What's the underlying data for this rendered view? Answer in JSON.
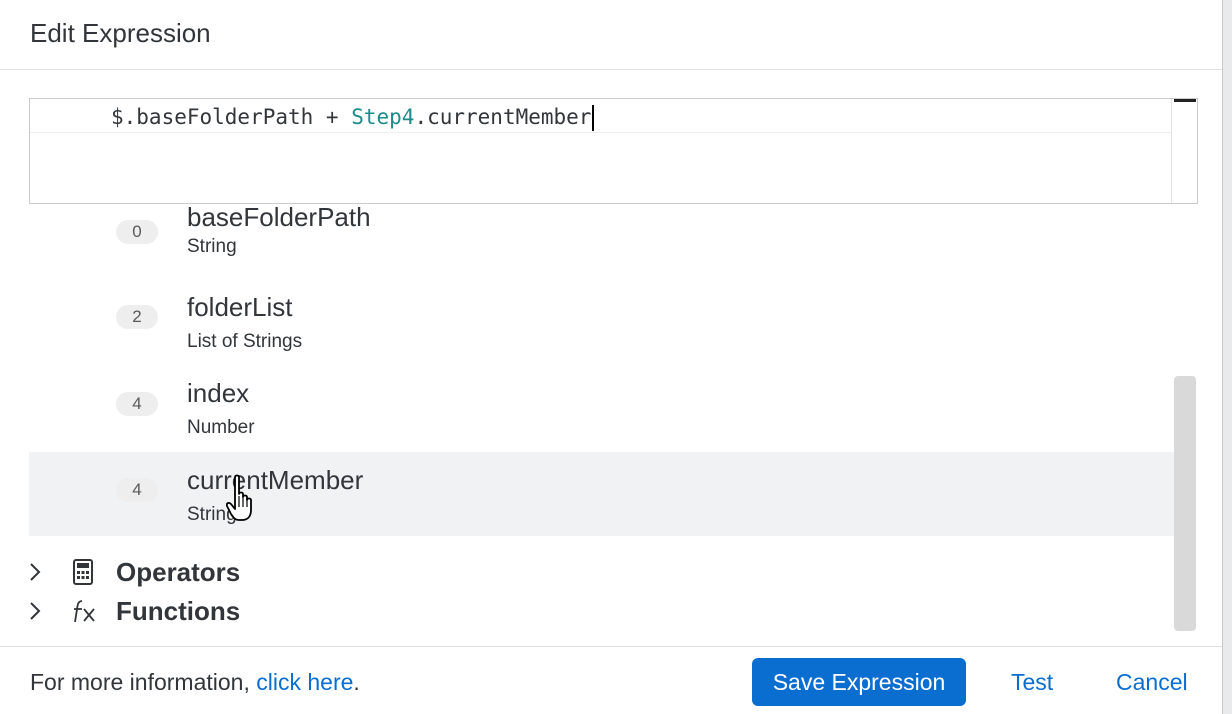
{
  "dialog": {
    "title": "Edit Expression"
  },
  "editor": {
    "code_prefix": "$.baseFolderPath + ",
    "code_step": "Step4",
    "code_suffix": ".currentMember"
  },
  "variables": [
    {
      "badge": "0",
      "name": "baseFolderPath",
      "type": "String"
    },
    {
      "badge": "2",
      "name": "folderList",
      "type": "List of Strings"
    },
    {
      "badge": "4",
      "name": "index",
      "type": "Number"
    },
    {
      "badge": "4",
      "name": "currentMember",
      "type": "String"
    }
  ],
  "tree": {
    "operators": "Operators",
    "functions": "Functions"
  },
  "footer": {
    "info_text": "For more information, ",
    "info_link": "click here",
    "info_end": ".",
    "save_label": "Save Expression",
    "test_label": "Test",
    "cancel_label": "Cancel"
  },
  "colors": {
    "accent": "#0a6ed1",
    "step_token": "#1f8a8a",
    "hover_row": "#f1f2f3"
  }
}
